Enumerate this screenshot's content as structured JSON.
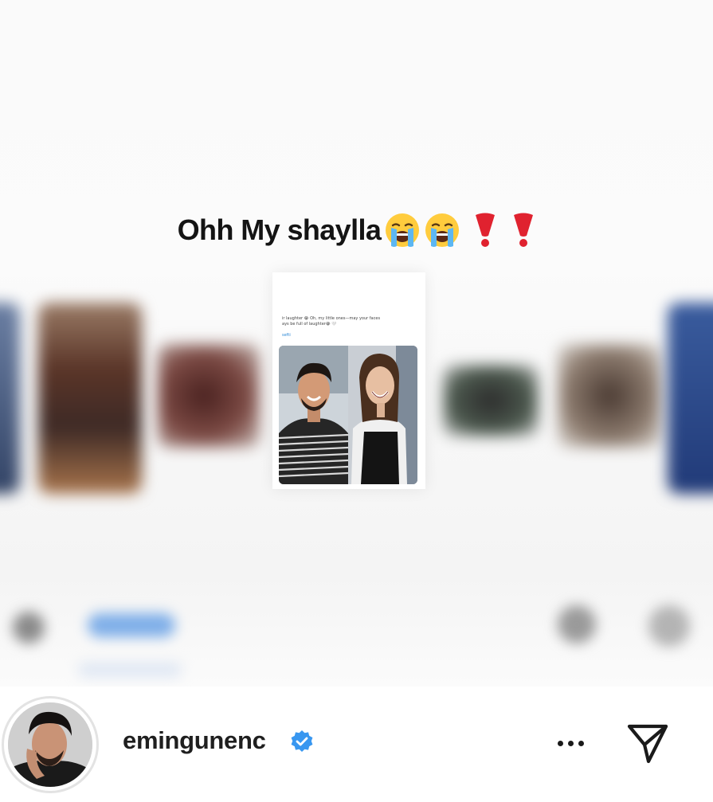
{
  "post": {
    "caption_text": "Ohh My shaylla",
    "caption_emojis": [
      "loudly-crying-face",
      "loudly-crying-face",
      "red-exclamation",
      "red-exclamation"
    ]
  },
  "shared_tweet": {
    "line1": "ir laughter 😭 Oh, my little ones—may your faces",
    "line2": "ays be full of laughter😭 🤍",
    "link": "sefti"
  },
  "footer": {
    "username": "emingunenc",
    "verified": true,
    "more_icon": "more-horizontal-icon",
    "share_icon": "send-icon"
  },
  "colors": {
    "verified_blue": "#3897f0",
    "text": "#1f1f1f",
    "accent_blur_blue": "#6fa6e8"
  }
}
